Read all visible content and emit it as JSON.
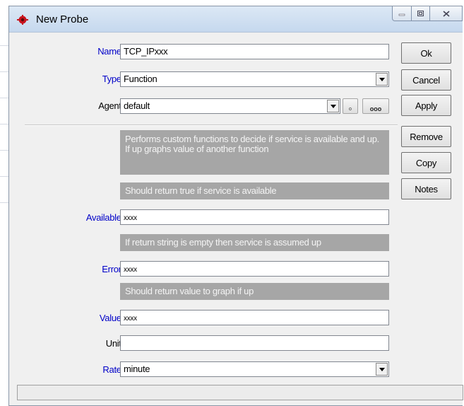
{
  "window": {
    "title": "New Probe",
    "icon": "red-gear-icon",
    "controls": [
      "minimize-icon",
      "maximize-icon",
      "close-icon"
    ]
  },
  "form": {
    "name": {
      "label": "Name:",
      "value": "TCP_IPxxx"
    },
    "type": {
      "label": "Type:",
      "value": "Function"
    },
    "agent": {
      "label": "Agent:",
      "value": "default",
      "browse_label": "ooo",
      "small_label": "o"
    },
    "descriptions": {
      "main": "Performs custom functions to decide if service is available and up. If up graphs value of another function",
      "available": "Should return true if service is available",
      "error": "If return string is empty then service is assumed up",
      "value": "Should return value to graph if up"
    },
    "colon": ":",
    "available": {
      "label": "Available:",
      "value": "xxxx"
    },
    "error": {
      "label": "Error:",
      "value": "xxxx"
    },
    "value": {
      "label": "Value:",
      "value": "xxxx"
    },
    "unit": {
      "label": "Unit:",
      "value": ""
    },
    "rate": {
      "label": "Rate:",
      "value": "minute"
    }
  },
  "buttons": {
    "ok": "Ok",
    "cancel": "Cancel",
    "apply": "Apply",
    "remove": "Remove",
    "copy": "Copy",
    "notes": "Notes"
  },
  "colors": {
    "label_blue": "#0000c8",
    "description_bg": "#a6a6a6",
    "window_bg": "#f0f0f0"
  }
}
